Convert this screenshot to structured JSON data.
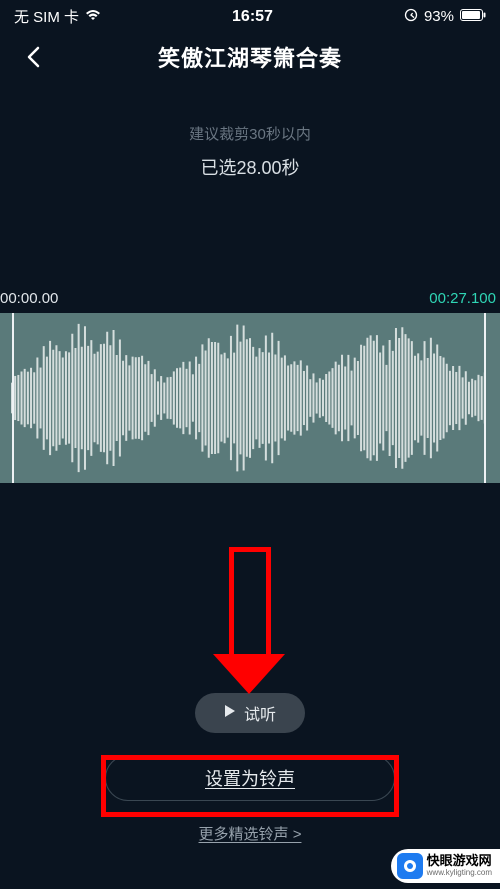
{
  "status": {
    "sim": "无 SIM 卡",
    "time": "16:57",
    "battery": "93%"
  },
  "header": {
    "title": "笑傲江湖琴箫合奏"
  },
  "trim": {
    "hint": "建议裁剪30秒以内",
    "selected": "已选28.00秒",
    "start": "00:00.00",
    "end": "00:27.100"
  },
  "buttons": {
    "preview": "试听",
    "set_ringtone": "设置为铃声",
    "more": "更多精选铃声 >"
  },
  "watermark": {
    "cn": "快眼游戏网",
    "en": "www.kyligting.com"
  }
}
